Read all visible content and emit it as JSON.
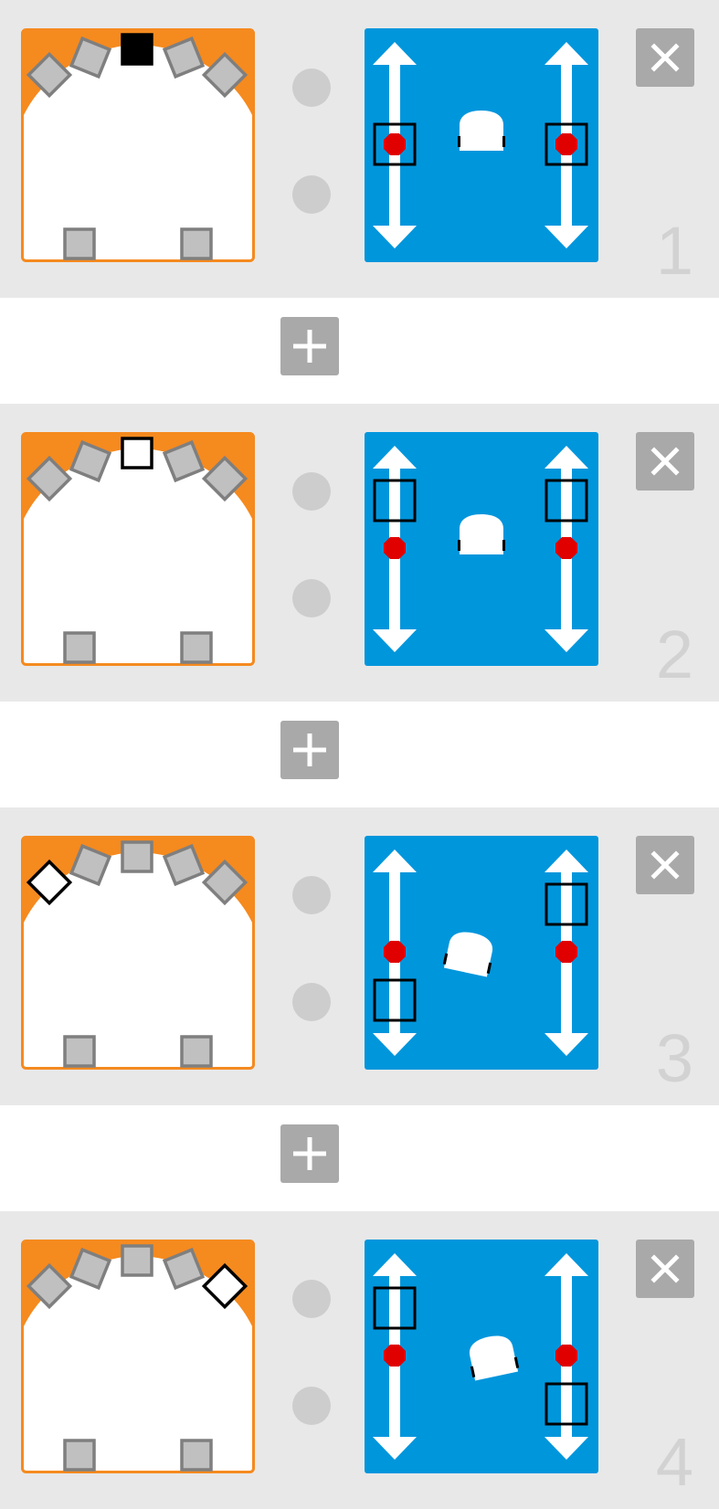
{
  "rules": [
    {
      "number": "1",
      "sensors": {
        "top": [
          "inactive",
          "inactive",
          "active",
          "inactive",
          "inactive"
        ],
        "bottom": [
          "inactive",
          "inactive"
        ]
      },
      "motors": {
        "left": {
          "control": "middle",
          "indicator": "middle"
        },
        "right": {
          "control": "middle",
          "indicator": "middle"
        },
        "robot_rotation_deg": 0
      }
    },
    {
      "number": "2",
      "sensors": {
        "top": [
          "inactive",
          "inactive",
          "inactive-outline",
          "inactive",
          "inactive"
        ],
        "bottom": [
          "inactive",
          "inactive"
        ]
      },
      "motors": {
        "left": {
          "control": "top",
          "indicator": "middle"
        },
        "right": {
          "control": "top",
          "indicator": "middle"
        },
        "robot_rotation_deg": 0
      }
    },
    {
      "number": "3",
      "sensors": {
        "top": [
          "inactive-outline",
          "inactive",
          "inactive",
          "inactive",
          "inactive"
        ],
        "bottom": [
          "inactive",
          "inactive"
        ]
      },
      "motors": {
        "left": {
          "control": "bottom",
          "indicator": "middle"
        },
        "right": {
          "control": "top",
          "indicator": "middle"
        },
        "robot_rotation_deg": 12
      }
    },
    {
      "number": "4",
      "sensors": {
        "top": [
          "inactive",
          "inactive",
          "inactive",
          "inactive",
          "inactive-outline"
        ],
        "bottom": [
          "inactive",
          "inactive"
        ]
      },
      "motors": {
        "left": {
          "control": "top",
          "indicator": "middle"
        },
        "right": {
          "control": "bottom",
          "indicator": "middle"
        },
        "robot_rotation_deg": -12
      }
    }
  ],
  "colors": {
    "row_bg": "#e8e8e8",
    "sensor_orange": "#f58a1f",
    "sensor_gray": "#c0c0c0",
    "sensor_gray_border": "#7f7f7f",
    "motor_blue": "#0096dc",
    "motor_indicator": "#e00000",
    "button_gray": "#a9a9a9",
    "led_gray": "#cdcdcd",
    "number_gray": "#d2d2d2"
  },
  "icons": {
    "delete": "close-icon",
    "add": "plus-icon"
  }
}
